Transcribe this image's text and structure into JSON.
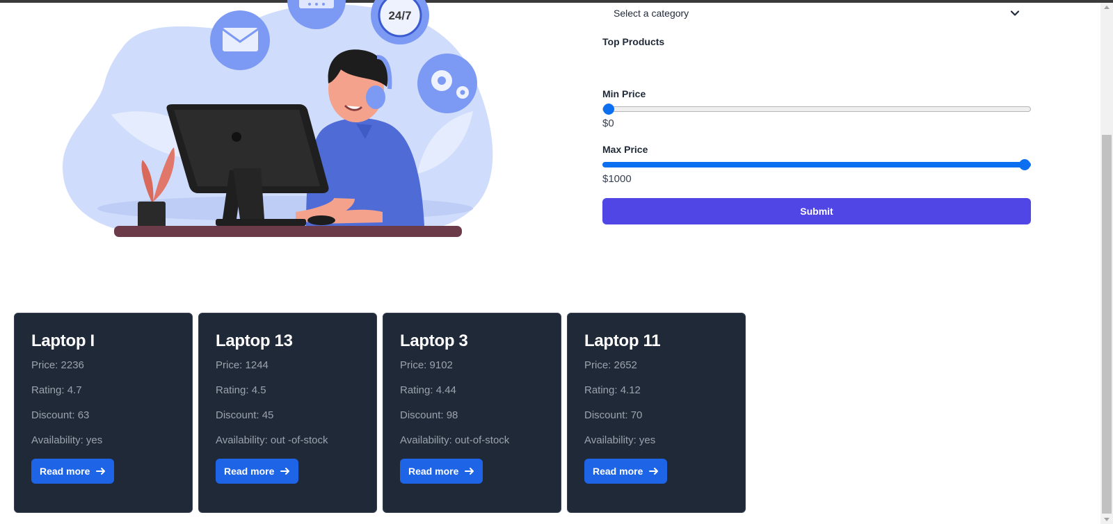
{
  "filters": {
    "category_placeholder": "Select a category",
    "top_products_label": "Top Products",
    "min_price_label": "Min Price",
    "min_price_value": "$0",
    "min_price_slider_level": 0.0,
    "max_price_label": "Max Price",
    "max_price_value": "$1000",
    "max_price_slider_level": 1.0,
    "submit_label": "Submit"
  },
  "illustration": {
    "badge_247": "24/7"
  },
  "products": [
    {
      "name": "Laptop I",
      "price": "Price: 2236",
      "rating": "Rating: 4.7",
      "discount": "Discount: 63",
      "availability": "Availability: yes",
      "cta": "Read more"
    },
    {
      "name": "Laptop 13",
      "price": "Price: 1244",
      "rating": "Rating: 4.5",
      "discount": "Discount: 45",
      "availability": "Availability: out -of-stock",
      "cta": "Read more"
    },
    {
      "name": "Laptop 3",
      "price": "Price: 9102",
      "rating": "Rating: 4.44",
      "discount": "Discount: 98",
      "availability": "Availability: out-of-stock",
      "cta": "Read more"
    },
    {
      "name": "Laptop 11",
      "price": "Price: 2652",
      "rating": "Rating: 4.12",
      "discount": "Discount: 70",
      "availability": "Availability: yes",
      "cta": "Read more"
    }
  ],
  "icons": {
    "category_dropdown": "chevron-down-icon",
    "read_more": "arrow-right-icon",
    "illustration_bubbles": [
      "calendar-icon",
      "clock-24-7-icon",
      "mail-icon",
      "gears-icon"
    ]
  },
  "colors": {
    "accent_submit": "#4f46e5",
    "slider_blue": "#0b6ff0",
    "card_bg": "#1f2937",
    "button_blue": "#1d64e6"
  }
}
